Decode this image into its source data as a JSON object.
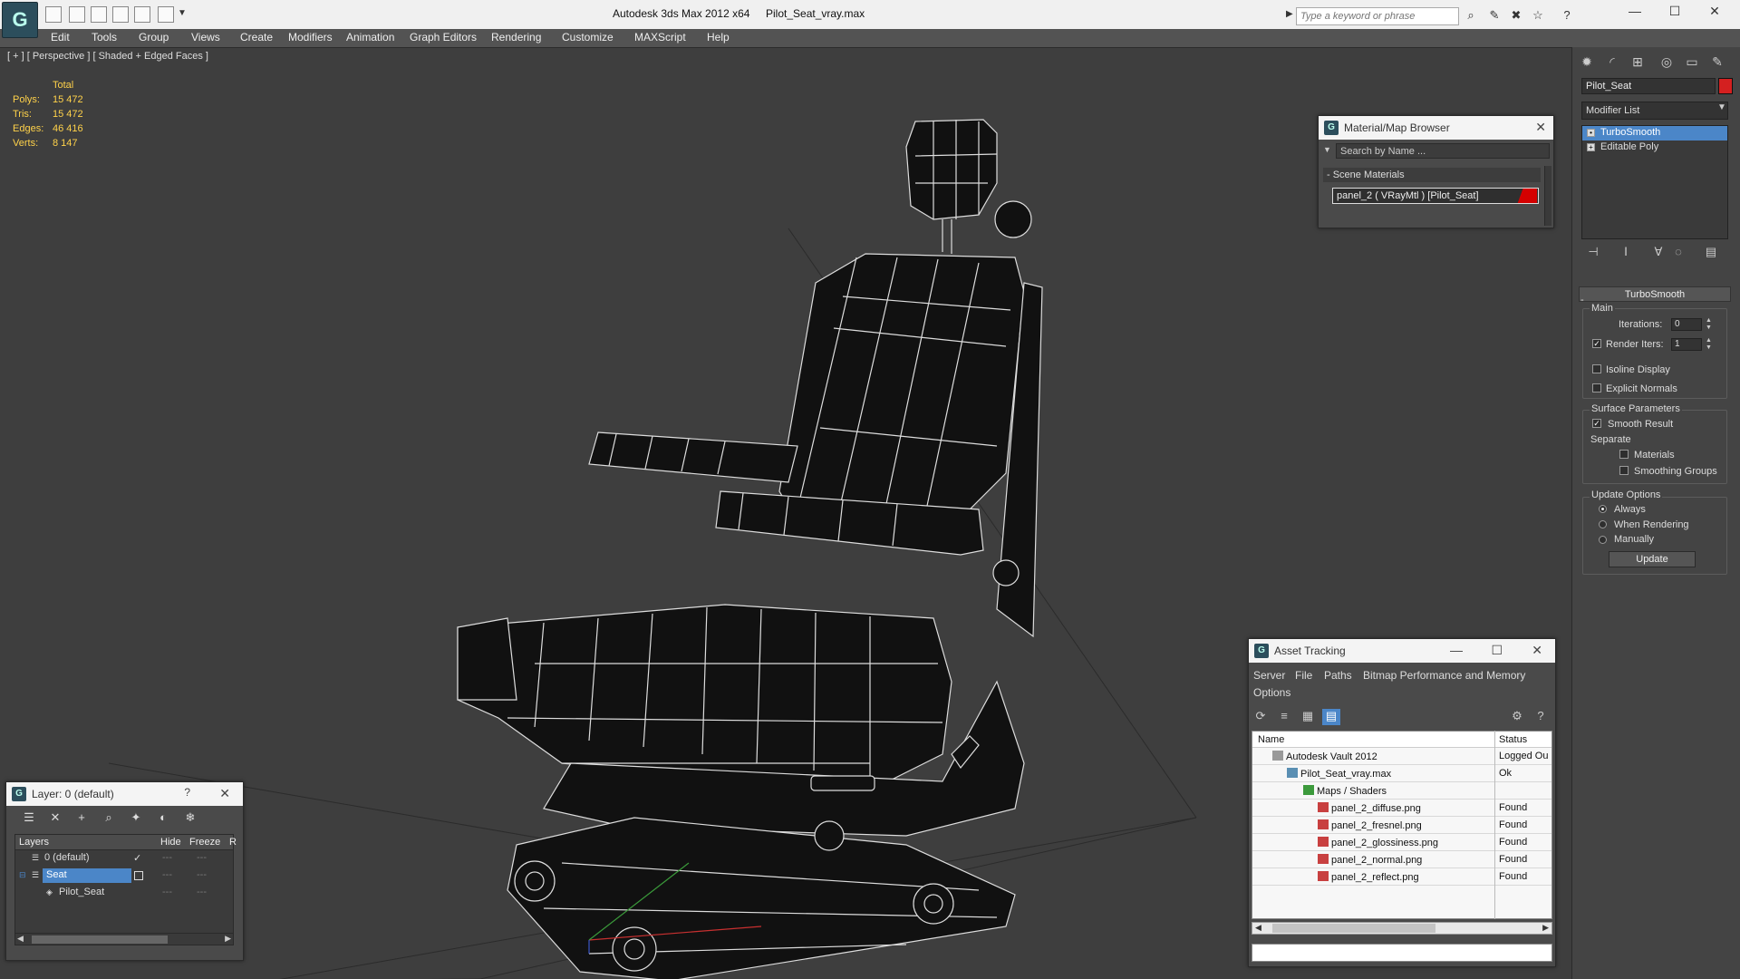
{
  "window": {
    "title": "Autodesk 3ds Max  2012 x64",
    "file": "Pilot_Seat_vray.max",
    "search_placeholder": "Type a keyword or phrase"
  },
  "menu": [
    "Edit",
    "Tools",
    "Group",
    "Views",
    "Create",
    "Modifiers",
    "Animation",
    "Graph Editors",
    "Rendering",
    "Customize",
    "MAXScript",
    "Help"
  ],
  "viewport": {
    "label": "[ + ] [ Perspective ] [ Shaded + Edged Faces ]",
    "stats": {
      "header": "Total",
      "rows": [
        {
          "label": "Polys:",
          "value": "15 472"
        },
        {
          "label": "Tris:",
          "value": "15 472"
        },
        {
          "label": "Edges:",
          "value": "46 416"
        },
        {
          "label": "Verts:",
          "value": "8 147"
        }
      ]
    }
  },
  "command_panel": {
    "object_name": "Pilot_Seat",
    "object_color": "#d42020",
    "modifier_list": "Modifier List",
    "stack": [
      {
        "label": "TurboSmooth",
        "selected": true
      },
      {
        "label": "Editable Poly",
        "selected": false
      }
    ],
    "rollout": {
      "title": "TurboSmooth",
      "main": "Main",
      "iterations_label": "Iterations:",
      "iterations_value": "0",
      "render_iters_label": "Render Iters:",
      "render_iters_value": "1",
      "isoline": "Isoline Display",
      "explicit_normals": "Explicit Normals",
      "surface_params": "Surface Parameters",
      "smooth_result": "Smooth Result",
      "separate": "Separate",
      "materials": "Materials",
      "smoothing_groups": "Smoothing Groups",
      "update_options": "Update Options",
      "always": "Always",
      "when_rendering": "When Rendering",
      "manually": "Manually",
      "update_button": "Update"
    }
  },
  "material_browser": {
    "title": "Material/Map Browser",
    "search_placeholder": "Search by Name ...",
    "group": "- Scene Materials",
    "item": "panel_2  ( VRayMtl )  [Pilot_Seat]"
  },
  "asset_tracking": {
    "title": "Asset Tracking",
    "menu": [
      "Server",
      "File",
      "Paths",
      "Bitmap Performance and Memory",
      "Options"
    ],
    "col_name": "Name",
    "col_status": "Status",
    "rows": [
      {
        "name": "Autodesk Vault 2012",
        "status": "Logged Ou",
        "indent": 1,
        "icon": "vault-icon"
      },
      {
        "name": "Pilot_Seat_vray.max",
        "status": "Ok",
        "indent": 2,
        "icon": "max-file-icon"
      },
      {
        "name": "Maps / Shaders",
        "status": "",
        "indent": 3,
        "icon": "maps-folder-icon"
      },
      {
        "name": "panel_2_diffuse.png",
        "status": "Found",
        "indent": 4,
        "icon": "png-icon"
      },
      {
        "name": "panel_2_fresnel.png",
        "status": "Found",
        "indent": 4,
        "icon": "png-icon"
      },
      {
        "name": "panel_2_glossiness.png",
        "status": "Found",
        "indent": 4,
        "icon": "png-icon"
      },
      {
        "name": "panel_2_normal.png",
        "status": "Found",
        "indent": 4,
        "icon": "png-icon"
      },
      {
        "name": "panel_2_reflect.png",
        "status": "Found",
        "indent": 4,
        "icon": "png-icon"
      }
    ]
  },
  "layer_dialog": {
    "title": "Layer: 0 (default)",
    "help": "?",
    "col_layers": "Layers",
    "col_hide": "Hide",
    "col_freeze": "Freeze",
    "col_render": "R",
    "rows": [
      {
        "name": "0 (default)",
        "checked": true,
        "selected": false
      },
      {
        "name": "Seat",
        "checked": false,
        "selected": true
      },
      {
        "name": "Pilot_Seat",
        "checked": false,
        "selected": false
      }
    ]
  }
}
